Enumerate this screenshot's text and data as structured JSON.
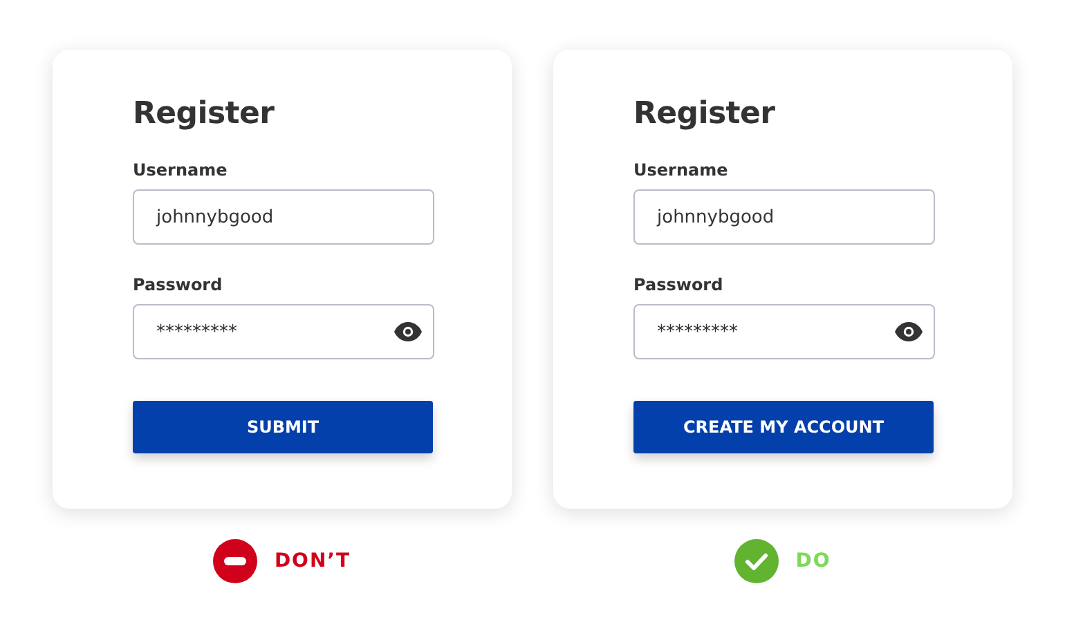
{
  "panels": [
    {
      "title": "Register",
      "fields": [
        {
          "label": "Username",
          "value": "johnnybgood",
          "kind": "text"
        },
        {
          "label": "Password",
          "value": "*********",
          "kind": "password"
        }
      ],
      "button": "SUBMIT",
      "verdict": {
        "kind": "dont",
        "label": "DON’T"
      }
    },
    {
      "title": "Register",
      "fields": [
        {
          "label": "Username",
          "value": "johnnybgood",
          "kind": "text"
        },
        {
          "label": "Password",
          "value": "*********",
          "kind": "password"
        }
      ],
      "button": "CREATE MY ACCOUNT",
      "verdict": {
        "kind": "do",
        "label": "DO"
      }
    }
  ]
}
